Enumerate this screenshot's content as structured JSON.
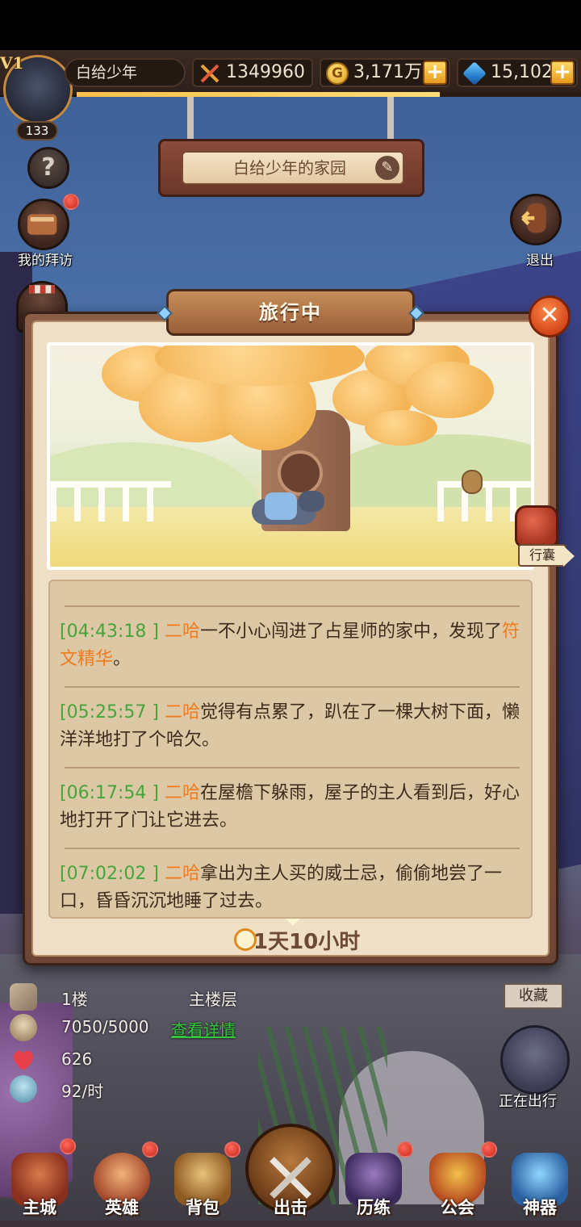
{
  "top_bar": {
    "vip_label": "V1",
    "level": "133",
    "player_name": "白给少年",
    "combat_power": "1349960",
    "gold": "3,171万",
    "gems": "15,102",
    "plus_symbol": "+",
    "gold_symbol": "G"
  },
  "homeland": {
    "title": "白给少年的家园"
  },
  "side_buttons": {
    "help": "?",
    "my_visits": "我的拜访",
    "exit": "退出"
  },
  "modal": {
    "title": "旅行中",
    "close": "✕",
    "bag_label": "行囊",
    "log": [
      {
        "time": "[04:43:18 ]",
        "who": " 二哈",
        "text": "一不小心闯进了占星师的家中，发现了",
        "highlight": "符文精华",
        "end": "。"
      },
      {
        "time": "[05:25:57 ]",
        "who": " 二哈",
        "text": "觉得有点累了，趴在了一棵大树下面，懒洋洋地打了个哈欠。",
        "highlight": "",
        "end": ""
      },
      {
        "time": "[06:17:54 ]",
        "who": " 二哈",
        "text": "在屋檐下躲雨，屋子的主人看到后，好心地打开了门让它进去。",
        "highlight": "",
        "end": ""
      },
      {
        "time": "[07:02:02 ]",
        "who": " 二哈",
        "text": "拿出为主人买的威士忌，偷偷地尝了一口，昏昏沉沉地睡了过去。",
        "highlight": "",
        "end": ""
      }
    ],
    "timer": "1天10小时"
  },
  "floor_info": {
    "floor": "1楼",
    "floor_type": "主楼层",
    "capacity": "7050/5000",
    "details_link": "查看详情",
    "hearts": "626",
    "rate": "92/时"
  },
  "right_panel": {
    "collect": "收藏",
    "traveling": "正在出行"
  },
  "bottom_nav": {
    "items": [
      "主城",
      "英雄",
      "背包",
      "出击",
      "历练",
      "公会",
      "神器"
    ]
  },
  "colors": {
    "timestamp": "#46a53a",
    "highlight": "#f07a1e",
    "link": "#33c63a"
  }
}
